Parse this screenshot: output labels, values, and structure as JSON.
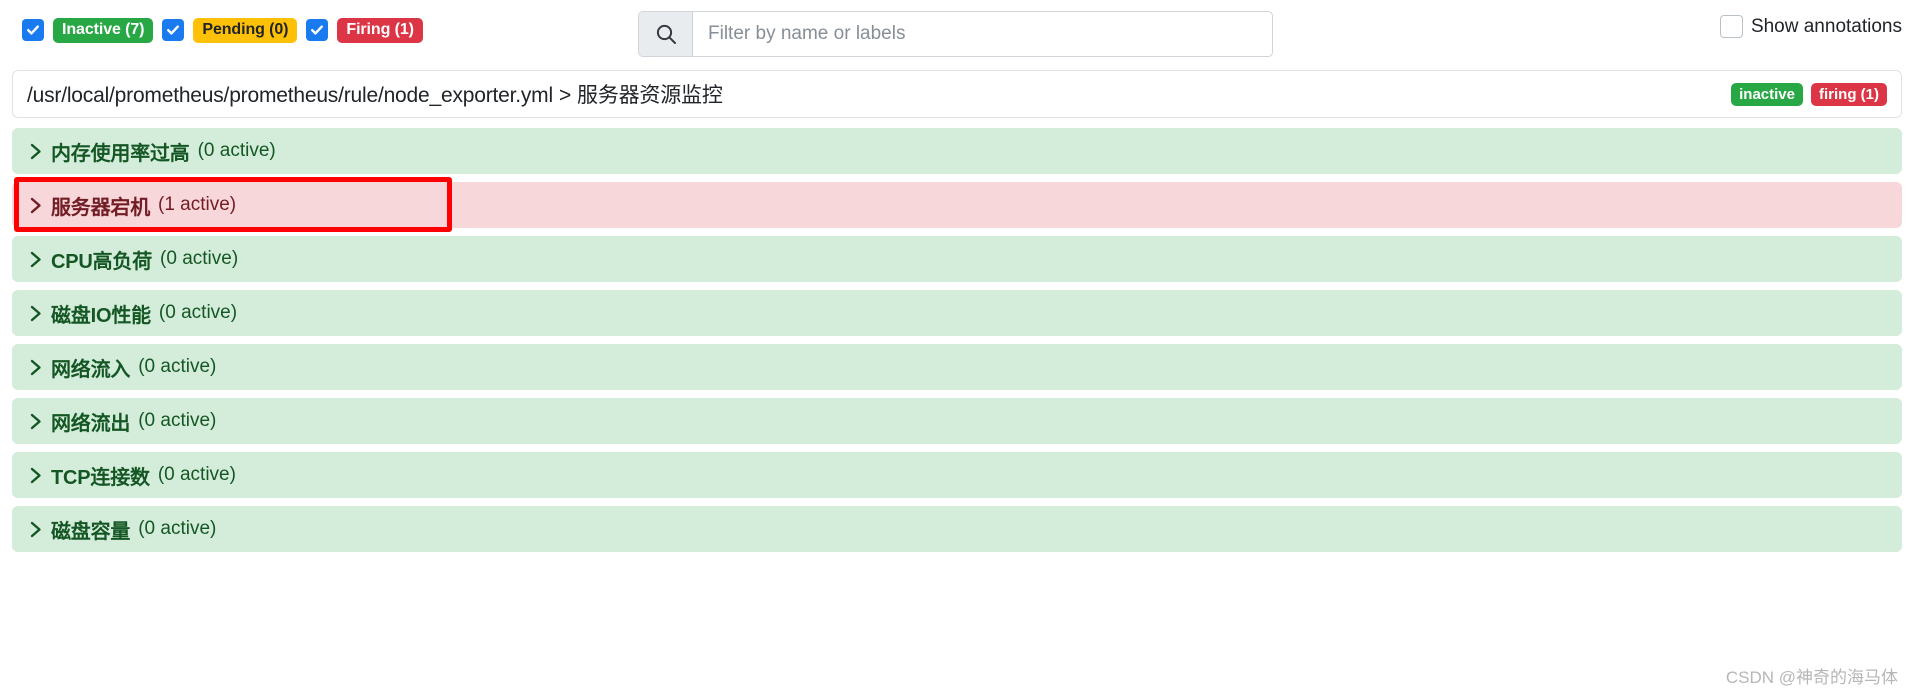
{
  "toolbar": {
    "filters": [
      {
        "label": "Inactive (7)",
        "state": "inactive",
        "checked": true,
        "color": "#28a745"
      },
      {
        "label": "Pending (0)",
        "state": "pending",
        "checked": true,
        "color": "#ffc107"
      },
      {
        "label": "Firing (1)",
        "state": "firing",
        "checked": true,
        "color": "#dc3545"
      }
    ],
    "search": {
      "icon": "search-icon",
      "value": "",
      "placeholder": "Filter by name or labels"
    },
    "show_annotations": {
      "label": "Show annotations",
      "checked": false
    }
  },
  "group": {
    "file_path": "/usr/local/prometheus/prometheus/rule/node_exporter.yml",
    "separator": ">",
    "group_name": "服务器资源监控",
    "badges": [
      {
        "label": "inactive",
        "kind": "inactive"
      },
      {
        "label": "firing (1)",
        "kind": "firing"
      }
    ]
  },
  "rules": [
    {
      "name": "内存使用率过高",
      "count": "(0 active)",
      "state": "ok",
      "expanded": false,
      "icon": "chevron-right-icon"
    },
    {
      "name": "服务器宕机",
      "count": "(1 active)",
      "state": "alert",
      "expanded": false,
      "icon": "chevron-right-icon"
    },
    {
      "name": "CPU高负荷",
      "count": "(0 active)",
      "state": "ok",
      "expanded": false,
      "icon": "chevron-right-icon"
    },
    {
      "name": "磁盘IO性能",
      "count": "(0 active)",
      "state": "ok",
      "expanded": false,
      "icon": "chevron-right-icon"
    },
    {
      "name": "网络流入",
      "count": "(0 active)",
      "state": "ok",
      "expanded": false,
      "icon": "chevron-right-icon"
    },
    {
      "name": "网络流出",
      "count": "(0 active)",
      "state": "ok",
      "expanded": false,
      "icon": "chevron-right-icon"
    },
    {
      "name": "TCP连接数",
      "count": "(0 active)",
      "state": "ok",
      "expanded": false,
      "icon": "chevron-right-icon"
    },
    {
      "name": "磁盘容量",
      "count": "(0 active)",
      "state": "ok",
      "expanded": false,
      "icon": "chevron-right-icon"
    }
  ],
  "annotation": {
    "highlight_color": "#ff0000",
    "target_rule": "服务器宕机"
  },
  "watermark": "CSDN @神奇的海马体"
}
